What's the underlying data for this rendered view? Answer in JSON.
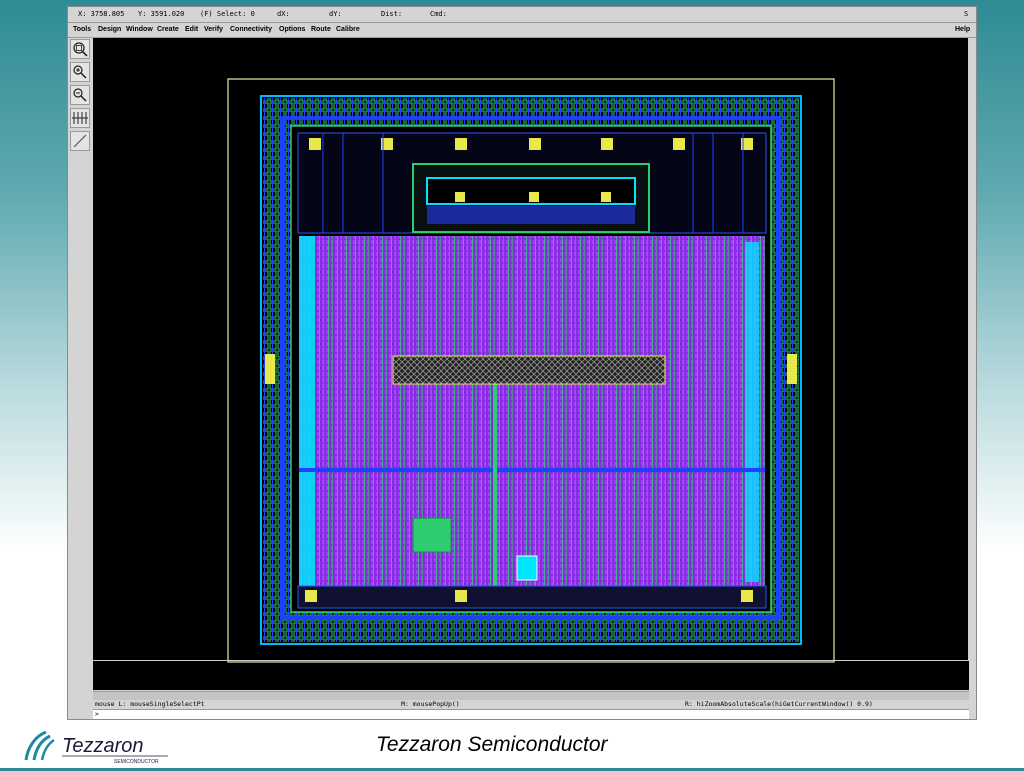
{
  "coords": {
    "x": "X:  3758.805",
    "y": "Y:  3591.020",
    "select": "(F) Select: 0",
    "dx": "dX:",
    "dy": "dY:",
    "dist": "Dist:",
    "cmd": "Cmd:",
    "corner": "S"
  },
  "menu": {
    "items": [
      "Tools",
      "Design",
      "Window",
      "Create",
      "Edit",
      "Verify",
      "Connectivity",
      "Options",
      "Route",
      "Calibre"
    ],
    "help": "Help"
  },
  "toolbar": {
    "icons": [
      "zoom-fit-icon",
      "zoom-in-icon",
      "zoom-out-icon",
      "pan-icon",
      "ruler-icon"
    ]
  },
  "status": {
    "left": "mouse L: mouseSingleSelectPt",
    "middle": "M: mousePopUp()",
    "right": "R: hiZoomAbsoluteScale(hiGetCurrentWindow() 0.9)"
  },
  "cmdline": {
    "prompt": ">"
  },
  "footer": {
    "title": "Tezzaron Semiconductor",
    "logo_text": "Tezzaron",
    "logo_sub": "SEMICONDUCTOR"
  },
  "colors": {
    "canvas": "#000000",
    "chip_purple": "#8a2be2",
    "chip_green": "#2ecc71",
    "chip_cyan": "#00e5ff",
    "chip_blue": "#2040ff",
    "pad_yellow": "#e8e84a",
    "boundary": "#e8f0a0"
  }
}
